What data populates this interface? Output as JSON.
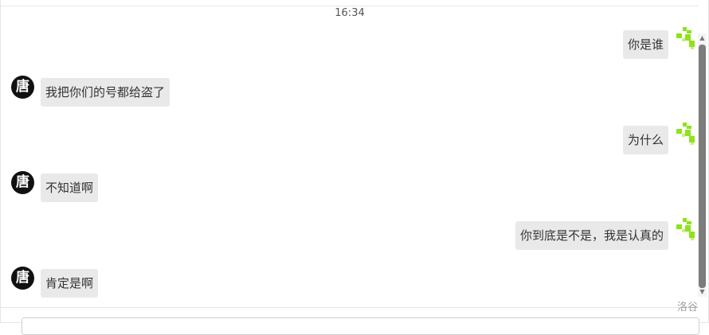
{
  "timestamp": "16:34",
  "messages": [
    {
      "side": "right",
      "text": "你是谁"
    },
    {
      "side": "left",
      "text": "我把你们的号都给盗了"
    },
    {
      "side": "right",
      "text": "为什么"
    },
    {
      "side": "left",
      "text": "不知道啊"
    },
    {
      "side": "right",
      "text": "你到底是不是，我是认真的"
    },
    {
      "side": "left",
      "text": "肯定是啊"
    }
  ],
  "left_avatar_char": "唐",
  "watermark": "洛谷",
  "colors": {
    "bubble": "#e9e9e9",
    "avatar_left_bg": "#111111",
    "avatar_right": "#8ee31a",
    "scroll_thumb": "#7c7c7c"
  },
  "icons": {
    "left_avatar": "tang-character-avatar",
    "right_avatar": "green-pixel-avatar",
    "scroll_up": "arrow-up",
    "scroll_down": "arrow-down"
  }
}
